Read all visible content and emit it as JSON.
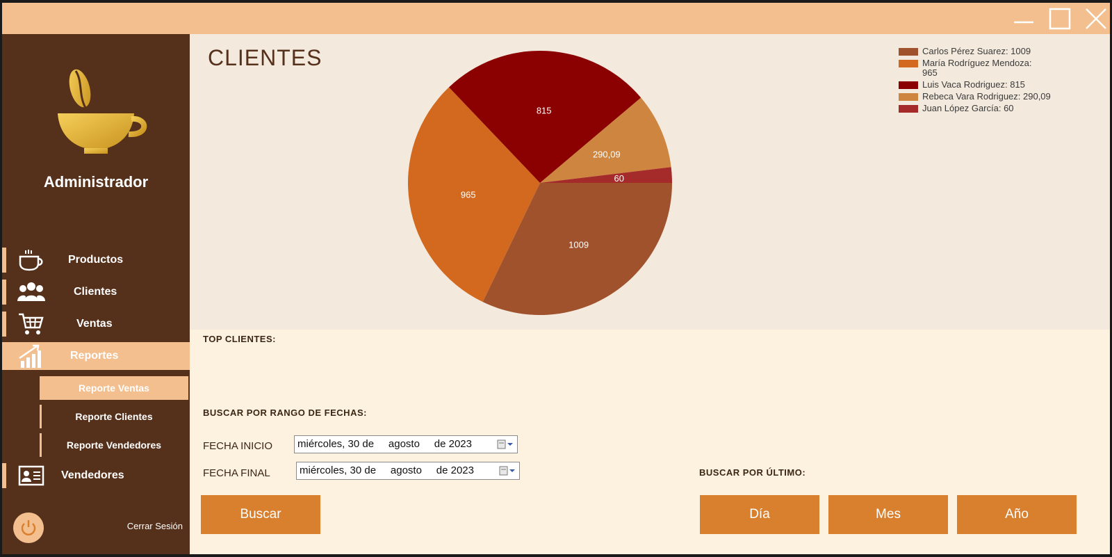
{
  "window": {
    "controls": [
      "minimize",
      "maximize",
      "close"
    ]
  },
  "sidebar": {
    "role": "Administrador",
    "items": [
      {
        "label": "Productos",
        "icon": "coffee-cup-icon"
      },
      {
        "label": "Clientes",
        "icon": "users-icon"
      },
      {
        "label": "Ventas",
        "icon": "cart-icon"
      },
      {
        "label": "Reportes",
        "icon": "bar-chart-icon",
        "active": true
      },
      {
        "label": "Vendedores",
        "icon": "id-card-icon"
      }
    ],
    "subitems": [
      {
        "label": "Reporte Ventas",
        "active": true
      },
      {
        "label": "Reporte Clientes"
      },
      {
        "label": "Reporte Vendedores"
      }
    ],
    "logout_label": "Cerrar Sesión"
  },
  "chart": {
    "title": "CLIENTES"
  },
  "chart_data": {
    "type": "pie",
    "slices": [
      {
        "name": "Carlos Pérez Suarez",
        "value": 1009,
        "label": "1009",
        "color": "#a0522d"
      },
      {
        "name": "María Rodríguez Mendoza",
        "value": 965,
        "label": "965",
        "color": "#d2691e"
      },
      {
        "name": "Luis Vaca Rodriguez",
        "value": 815,
        "label": "815",
        "color": "#8b0000"
      },
      {
        "name": "Rebeca Vara Rodriguez",
        "value": 290.09,
        "label": "290,09",
        "color": "#cd853f"
      },
      {
        "name": "Juan López García",
        "value": 60,
        "label": "60",
        "color": "#a52a2a"
      }
    ],
    "legend": [
      "Carlos Pérez Suarez: 1009",
      "María Rodríguez Mendoza:\n965",
      "Luis Vaca Rodriguez: 815",
      "Rebeca Vara Rodriguez: 290,09",
      "Juan López García: 60"
    ],
    "legend_position": "top-right"
  },
  "report": {
    "top_clients_label": "TOP CLIENTES:",
    "date_range_label": "BUSCAR POR RANGO DE FECHAS:",
    "start_label": "FECHA INICIO",
    "end_label": "FECHA FINAL",
    "start_value": "miércoles, 30 de     agosto     de 2023",
    "end_value": "miércoles, 30 de     agosto     de 2023",
    "search_button": "Buscar",
    "last_label": "BUSCAR POR ÚLTIMO:",
    "day_button": "Día",
    "month_button": "Mes",
    "year_button": "Año"
  }
}
